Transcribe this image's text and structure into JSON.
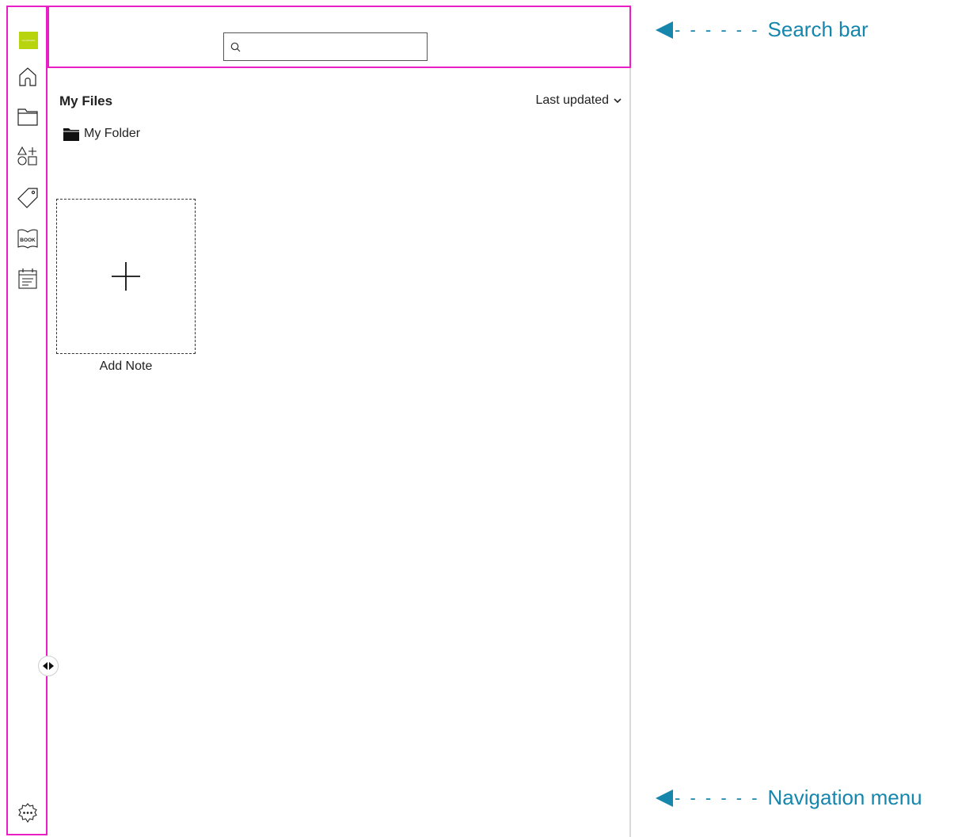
{
  "nav": {
    "logo_text": "remarkable",
    "items": [
      {
        "name": "home",
        "icon": "home-icon"
      },
      {
        "name": "files",
        "icon": "folder-icon"
      },
      {
        "name": "templates",
        "icon": "shapes-icon"
      },
      {
        "name": "tags",
        "icon": "tag-icon"
      },
      {
        "name": "ebooks",
        "icon": "book-icon",
        "badge": "BOOK"
      },
      {
        "name": "notes",
        "icon": "calendar-notes-icon"
      }
    ],
    "settings_icon": "settings-gear-icon",
    "collapse_icon": "collapse-toggle-icon"
  },
  "search": {
    "placeholder": "",
    "value": ""
  },
  "main": {
    "title": "My Files",
    "sort_label": "Last updated",
    "folders": [
      {
        "label": "My Folder"
      }
    ],
    "add_note_label": "Add Note"
  },
  "annotations": {
    "search_bar": "Search bar",
    "navigation_menu": "Navigation menu",
    "dashes": "- - - - - -"
  },
  "colors": {
    "highlight": "#e91ec5",
    "annotation": "#1686ad",
    "brand": "#b8d40f"
  }
}
